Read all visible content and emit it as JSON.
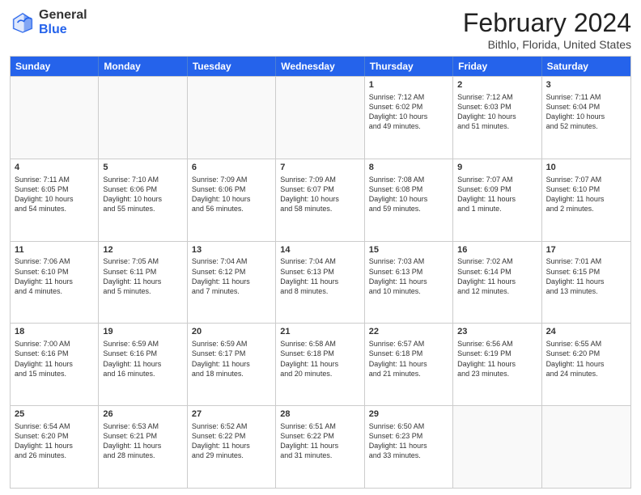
{
  "header": {
    "logo_general": "General",
    "logo_blue": "Blue",
    "title": "February 2024",
    "location": "Bithlo, Florida, United States"
  },
  "days_of_week": [
    "Sunday",
    "Monday",
    "Tuesday",
    "Wednesday",
    "Thursday",
    "Friday",
    "Saturday"
  ],
  "weeks": [
    [
      {
        "day": "",
        "info": ""
      },
      {
        "day": "",
        "info": ""
      },
      {
        "day": "",
        "info": ""
      },
      {
        "day": "",
        "info": ""
      },
      {
        "day": "1",
        "info": "Sunrise: 7:12 AM\nSunset: 6:02 PM\nDaylight: 10 hours\nand 49 minutes."
      },
      {
        "day": "2",
        "info": "Sunrise: 7:12 AM\nSunset: 6:03 PM\nDaylight: 10 hours\nand 51 minutes."
      },
      {
        "day": "3",
        "info": "Sunrise: 7:11 AM\nSunset: 6:04 PM\nDaylight: 10 hours\nand 52 minutes."
      }
    ],
    [
      {
        "day": "4",
        "info": "Sunrise: 7:11 AM\nSunset: 6:05 PM\nDaylight: 10 hours\nand 54 minutes."
      },
      {
        "day": "5",
        "info": "Sunrise: 7:10 AM\nSunset: 6:06 PM\nDaylight: 10 hours\nand 55 minutes."
      },
      {
        "day": "6",
        "info": "Sunrise: 7:09 AM\nSunset: 6:06 PM\nDaylight: 10 hours\nand 56 minutes."
      },
      {
        "day": "7",
        "info": "Sunrise: 7:09 AM\nSunset: 6:07 PM\nDaylight: 10 hours\nand 58 minutes."
      },
      {
        "day": "8",
        "info": "Sunrise: 7:08 AM\nSunset: 6:08 PM\nDaylight: 10 hours\nand 59 minutes."
      },
      {
        "day": "9",
        "info": "Sunrise: 7:07 AM\nSunset: 6:09 PM\nDaylight: 11 hours\nand 1 minute."
      },
      {
        "day": "10",
        "info": "Sunrise: 7:07 AM\nSunset: 6:10 PM\nDaylight: 11 hours\nand 2 minutes."
      }
    ],
    [
      {
        "day": "11",
        "info": "Sunrise: 7:06 AM\nSunset: 6:10 PM\nDaylight: 11 hours\nand 4 minutes."
      },
      {
        "day": "12",
        "info": "Sunrise: 7:05 AM\nSunset: 6:11 PM\nDaylight: 11 hours\nand 5 minutes."
      },
      {
        "day": "13",
        "info": "Sunrise: 7:04 AM\nSunset: 6:12 PM\nDaylight: 11 hours\nand 7 minutes."
      },
      {
        "day": "14",
        "info": "Sunrise: 7:04 AM\nSunset: 6:13 PM\nDaylight: 11 hours\nand 8 minutes."
      },
      {
        "day": "15",
        "info": "Sunrise: 7:03 AM\nSunset: 6:13 PM\nDaylight: 11 hours\nand 10 minutes."
      },
      {
        "day": "16",
        "info": "Sunrise: 7:02 AM\nSunset: 6:14 PM\nDaylight: 11 hours\nand 12 minutes."
      },
      {
        "day": "17",
        "info": "Sunrise: 7:01 AM\nSunset: 6:15 PM\nDaylight: 11 hours\nand 13 minutes."
      }
    ],
    [
      {
        "day": "18",
        "info": "Sunrise: 7:00 AM\nSunset: 6:16 PM\nDaylight: 11 hours\nand 15 minutes."
      },
      {
        "day": "19",
        "info": "Sunrise: 6:59 AM\nSunset: 6:16 PM\nDaylight: 11 hours\nand 16 minutes."
      },
      {
        "day": "20",
        "info": "Sunrise: 6:59 AM\nSunset: 6:17 PM\nDaylight: 11 hours\nand 18 minutes."
      },
      {
        "day": "21",
        "info": "Sunrise: 6:58 AM\nSunset: 6:18 PM\nDaylight: 11 hours\nand 20 minutes."
      },
      {
        "day": "22",
        "info": "Sunrise: 6:57 AM\nSunset: 6:18 PM\nDaylight: 11 hours\nand 21 minutes."
      },
      {
        "day": "23",
        "info": "Sunrise: 6:56 AM\nSunset: 6:19 PM\nDaylight: 11 hours\nand 23 minutes."
      },
      {
        "day": "24",
        "info": "Sunrise: 6:55 AM\nSunset: 6:20 PM\nDaylight: 11 hours\nand 24 minutes."
      }
    ],
    [
      {
        "day": "25",
        "info": "Sunrise: 6:54 AM\nSunset: 6:20 PM\nDaylight: 11 hours\nand 26 minutes."
      },
      {
        "day": "26",
        "info": "Sunrise: 6:53 AM\nSunset: 6:21 PM\nDaylight: 11 hours\nand 28 minutes."
      },
      {
        "day": "27",
        "info": "Sunrise: 6:52 AM\nSunset: 6:22 PM\nDaylight: 11 hours\nand 29 minutes."
      },
      {
        "day": "28",
        "info": "Sunrise: 6:51 AM\nSunset: 6:22 PM\nDaylight: 11 hours\nand 31 minutes."
      },
      {
        "day": "29",
        "info": "Sunrise: 6:50 AM\nSunset: 6:23 PM\nDaylight: 11 hours\nand 33 minutes."
      },
      {
        "day": "",
        "info": ""
      },
      {
        "day": "",
        "info": ""
      }
    ]
  ]
}
